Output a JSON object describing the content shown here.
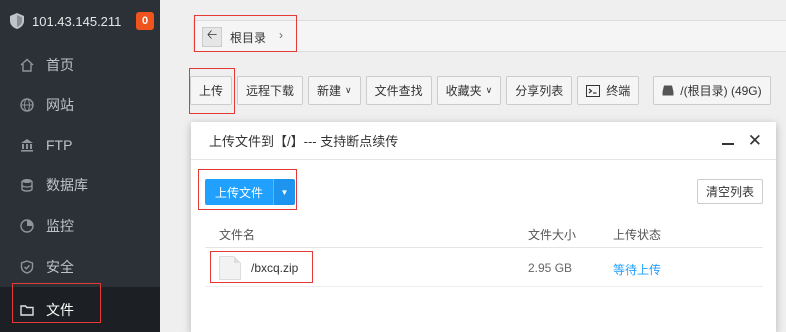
{
  "server": {
    "ip": "101.43.145.211",
    "badge": "0"
  },
  "sidebar": {
    "items": [
      {
        "label": "首页",
        "icon": "home-icon"
      },
      {
        "label": "网站",
        "icon": "globe-icon"
      },
      {
        "label": "FTP",
        "icon": "ftp-icon"
      },
      {
        "label": "数据库",
        "icon": "database-icon"
      },
      {
        "label": "监控",
        "icon": "monitor-icon"
      },
      {
        "label": "安全",
        "icon": "shield-icon"
      },
      {
        "label": "文件",
        "icon": "folder-icon"
      }
    ]
  },
  "breadcrumb": {
    "root_label": "根目录",
    "sep": "›"
  },
  "toolbar": {
    "upload": "上传",
    "remote_download": "远程下载",
    "new": "新建",
    "file_search": "文件查找",
    "favorites": "收藏夹",
    "share_list": "分享列表",
    "terminal": "终端",
    "disk": "/(根目录) (49G)"
  },
  "modal": {
    "title": "上传文件到【/】--- 支持断点续传",
    "upload_button": "上传文件",
    "clear_button": "清空列表",
    "columns": {
      "name": "文件名",
      "size": "文件大小",
      "status": "上传状态"
    },
    "rows": [
      {
        "name": "/bxcq.zip",
        "size": "2.95 GB",
        "status": "等待上传"
      }
    ]
  },
  "colors": {
    "accent": "#20a0ff",
    "sidebar_bg": "#2c3138",
    "highlight_box": "#e53935"
  }
}
